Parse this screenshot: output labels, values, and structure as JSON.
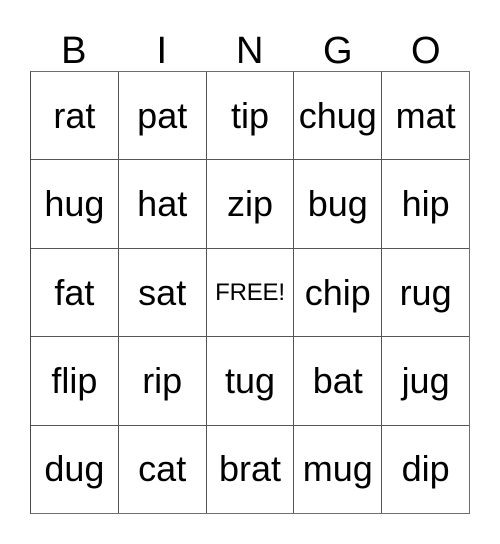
{
  "card": {
    "type": "word-bingo-card",
    "background_color": "#ffffff",
    "text_color": "#000000",
    "grid_line_color": "#555555",
    "border_color": "#6e6e6e"
  },
  "header": {
    "letters": [
      "B",
      "I",
      "N",
      "G",
      "O"
    ]
  },
  "grid": {
    "columns": 5,
    "rows": 5,
    "free_space": {
      "row": 2,
      "column": 2,
      "label": "FREE!"
    },
    "cells": [
      [
        "rat",
        "pat",
        "tip",
        "chug",
        "mat"
      ],
      [
        "hug",
        "hat",
        "zip",
        "bug",
        "hip"
      ],
      [
        "fat",
        "sat",
        "FREE!",
        "chip",
        "rug"
      ],
      [
        "flip",
        "rip",
        "tug",
        "bat",
        "jug"
      ],
      [
        "dug",
        "cat",
        "brat",
        "mug",
        "dip"
      ]
    ]
  }
}
